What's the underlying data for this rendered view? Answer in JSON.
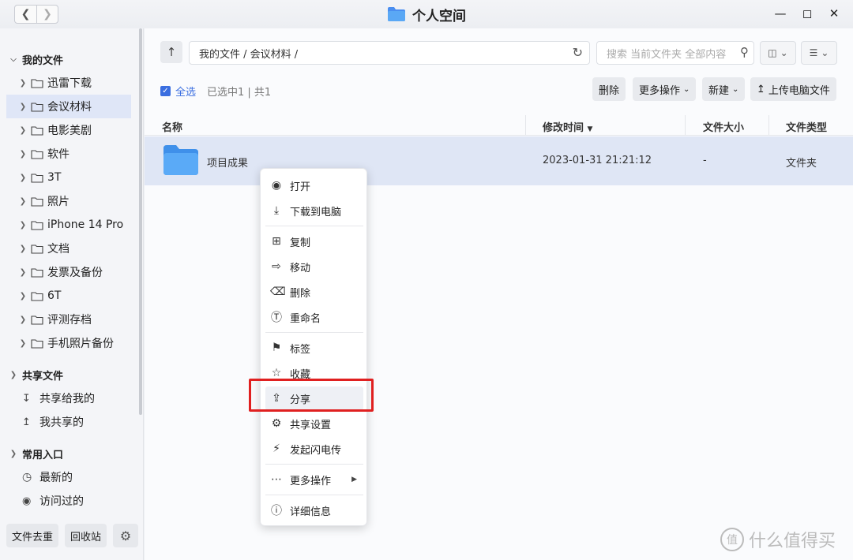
{
  "window": {
    "title": "个人空间"
  },
  "sidebar": {
    "my_files": "我的文件",
    "folders": [
      "迅雷下载",
      "会议材料",
      "电影美剧",
      "软件",
      "3T",
      "照片",
      "iPhone 14 Pro",
      "文档",
      "发票及备份",
      "6T",
      "评测存档",
      "手机照片备份"
    ],
    "shared_section": "共享文件",
    "shared_items": [
      "共享给我的",
      "我共享的"
    ],
    "common_section": "常用入口",
    "common_items": [
      "最新的",
      "访问过的"
    ],
    "dedupe_btn": "文件去重",
    "recycle_btn": "回收站"
  },
  "toolbar": {
    "path": "我的文件 / 会议材料 /",
    "search_placeholder": "搜索 当前文件夹 全部内容",
    "select_all": "全选",
    "selection_count": "已选中1 | 共1",
    "delete": "删除",
    "more_actions": "更多操作",
    "new": "新建",
    "upload": "上传电脑文件"
  },
  "table": {
    "headers": {
      "name": "名称",
      "modified": "修改时间",
      "size": "文件大小",
      "type": "文件类型"
    },
    "rows": [
      {
        "name": "项目成果",
        "modified": "2023-01-31 21:21:12",
        "size": "-",
        "type": "文件夹"
      }
    ]
  },
  "context_menu": {
    "open": "打开",
    "download": "下载到电脑",
    "copy": "复制",
    "move": "移动",
    "delete": "删除",
    "rename": "重命名",
    "tag": "标签",
    "favorite": "收藏",
    "share": "分享",
    "share_settings": "共享设置",
    "flash_transfer": "发起闪电传",
    "more": "更多操作",
    "details": "详细信息"
  },
  "watermark": {
    "text": "什么值得买",
    "logo": "值"
  },
  "colors": {
    "accent": "#3a6ee0",
    "highlight": "#e02020",
    "folder": "#5aa8f5"
  }
}
